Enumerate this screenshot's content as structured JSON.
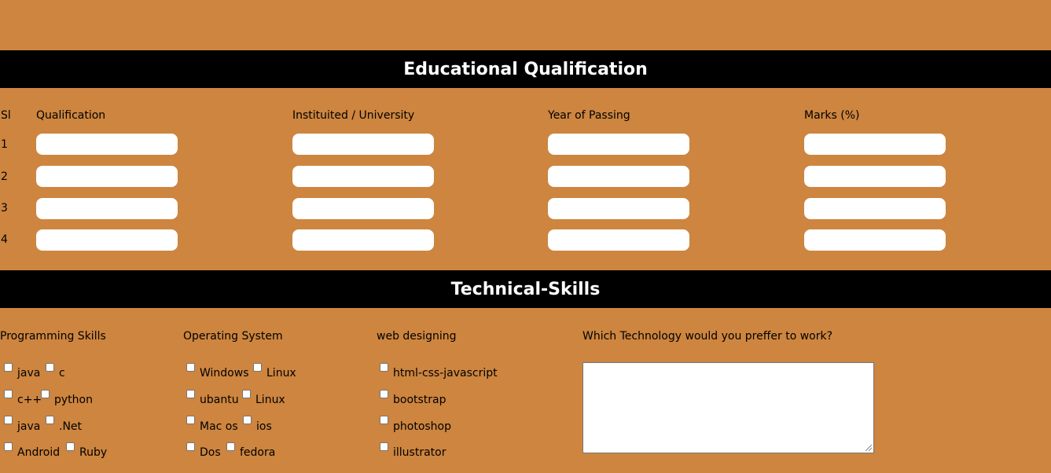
{
  "education": {
    "title": "Educational Qualification",
    "headers": {
      "sl": "Sl",
      "qualification": "Qualification",
      "institute": "Instituited / University",
      "year": "Year of Passing",
      "marks": "Marks (%)"
    },
    "rows": [
      "1",
      "2",
      "3",
      "4"
    ]
  },
  "skills": {
    "title": "Technical-Skills",
    "programming": {
      "heading": "Programming Skills",
      "items": [
        "java",
        "c",
        "c++",
        "python",
        "java",
        ".Net",
        "Android",
        "Ruby"
      ]
    },
    "os": {
      "heading": "Operating System",
      "items": [
        "Windows",
        "Linux",
        "ubantu",
        "Linux",
        "Mac os",
        "ios",
        "Dos",
        "fedora"
      ]
    },
    "web": {
      "heading": "web designing",
      "items": [
        "html-css-javascript",
        "bootstrap",
        "photoshop",
        "illustrator"
      ]
    },
    "preference": {
      "question": "Which Technology would you preffer to work?"
    }
  }
}
